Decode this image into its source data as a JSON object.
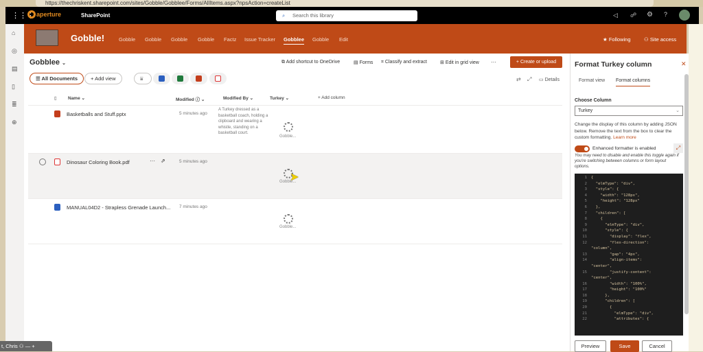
{
  "browser": {
    "url": "https://thechriskent.sharepoint.com/sites/Gobble/Gobblee/Forms/AllItems.aspx?npsAction=createList"
  },
  "suitebar": {
    "brand": "aperture",
    "app": "SharePoint",
    "search_placeholder": "Search this library"
  },
  "site": {
    "title": "Gobble!",
    "nav": [
      "Gobble",
      "Gobble",
      "Gobble",
      "Gobble",
      "Factz",
      "Issue Tracker",
      "Gobblee",
      "Gobble",
      "Edit"
    ],
    "active_nav": "Gobblee",
    "following": "Following",
    "site_access": "Site access"
  },
  "library": {
    "title": "Gobblee",
    "commands": {
      "shortcut": "Add shortcut to OneDrive",
      "forms": "Forms",
      "classify": "Classify and extract",
      "grid": "Edit in grid view",
      "more": "···",
      "create": "Create or upload",
      "details": "Details"
    },
    "views": {
      "all": "All Documents",
      "add": "Add view"
    },
    "columns": {
      "name": "Name",
      "modified": "Modified",
      "modified_by": "Modified By",
      "turkey": "Turkey",
      "add": "Add column"
    },
    "rows": [
      {
        "name": "Basketballs and Stuff.pptx",
        "type": "pptx",
        "modified": "5 minutes ago",
        "description": "A Turkey dressed as a basketball coach, holding a clipboard and wearing a whistle, standing on a basketball court.",
        "turkey": "Gobble..."
      },
      {
        "name": "Dinosaur Coloring Book.pdf",
        "type": "pdf",
        "modified": "5 minutes ago",
        "description": "",
        "turkey": "Gobble..."
      },
      {
        "name": "MANUAL04D2 - Strapless Grenade Launch...",
        "type": "docx",
        "modified": "7 minutes ago",
        "description": "",
        "turkey": "Gobble..."
      }
    ]
  },
  "panel": {
    "title": "Format Turkey column",
    "tabs": [
      "Format view",
      "Format columns"
    ],
    "active_tab": "Format columns",
    "choose_label": "Choose Column",
    "column_value": "Turkey",
    "help": "Change the display of this column by adding JSON below. Remove the text from the box to clear the custom formatting.",
    "learn_more": "Learn more",
    "toggle_label": "Enhanced formatter is enabled",
    "toggle_on": true,
    "toggle_note": "You may need to disable and enable this toggle again if you're switching between columns or form layout options.",
    "code": [
      "{",
      "  \"elmType\": \"div\",",
      "  \"style\": {",
      "    \"width\": \"128px\",",
      "    \"height\": \"128px\"",
      "  },",
      "  \"children\": [",
      "    {",
      "      \"elmType\": \"div\",",
      "      \"style\": {",
      "        \"display\": \"flex\",",
      "        \"flex-direction\":",
      "\"column\",",
      "        \"gap\": \"4px\",",
      "        \"align-items\":",
      "\"center\",",
      "        \"justify-content\":",
      "\"center\",",
      "        \"width\": \"100%\",",
      "        \"height\": \"100%\"",
      "      },",
      "      \"children\": [",
      "        {",
      "          \"elmType\": \"div\",",
      "          \"attributes\": {"
    ],
    "line_numbers": [
      "1",
      "2",
      "3",
      "4",
      "5",
      "6",
      "7",
      "8",
      "9",
      "10",
      "11",
      "12",
      "",
      "13",
      "14",
      "",
      "15",
      "",
      "16",
      "17",
      "18",
      "19",
      "20",
      "21",
      "22"
    ],
    "preview": "Preview",
    "save": "Save",
    "cancel": "Cancel"
  },
  "taskbar": {
    "label": "t, Chris"
  },
  "colors": {
    "accent": "#bf4a17"
  }
}
